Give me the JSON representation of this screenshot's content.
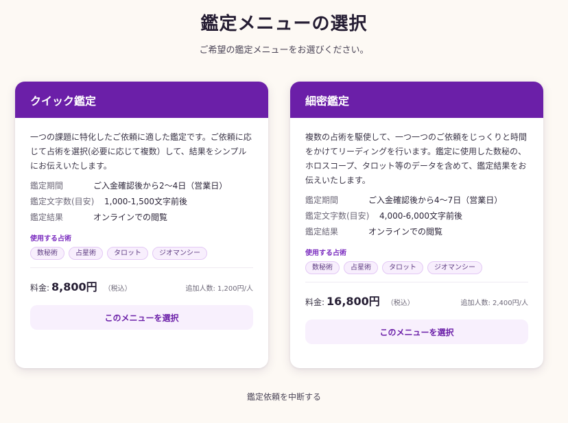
{
  "page": {
    "title": "鑑定メニューの選択",
    "subtitle": "ご希望の鑑定メニューをお選びください。",
    "cancel_label": "鑑定依頼を中断する"
  },
  "colors": {
    "accent": "#6b1fa8",
    "background": "#fdf9f4",
    "tag_bg": "#f8effd"
  },
  "cards": [
    {
      "title": "クイック鑑定",
      "description": "一つの課題に特化したご依頼に適した鑑定です。ご依頼に応じて占術を選択(必要に応じて複数）して、結果をシンプルにお伝えいたします。",
      "period_label": "鑑定期間",
      "period_value": "ご入金確認後から2〜4日（営業日）",
      "chars_label": "鑑定文字数(目安)",
      "chars_value": "1,000-1,500文字前後",
      "result_label": "鑑定結果",
      "result_value": "オンラインでの閲覧",
      "techniques_label": "使用する占術",
      "techniques": [
        "数秘術",
        "占星術",
        "タロット",
        "ジオマンシー"
      ],
      "price_label": "料金:",
      "price": "8,800円",
      "tax": "（税込）",
      "extra_fee": "追加人数: 1,200円/人",
      "button_label": "このメニューを選択"
    },
    {
      "title": "細密鑑定",
      "description": "複数の占術を駆使して、一つ一つのご依頼をじっくりと時間をかけてリーディングを行います。鑑定に使用した数秘の、ホロスコープ、タロット等のデータを含めて、鑑定結果をお伝えいたします。",
      "period_label": "鑑定期間",
      "period_value": "ご入金確認後から4〜7日（営業日）",
      "chars_label": "鑑定文字数(目安)",
      "chars_value": "4,000-6,000文字前後",
      "result_label": "鑑定結果",
      "result_value": "オンラインでの閲覧",
      "techniques_label": "使用する占術",
      "techniques": [
        "数秘術",
        "占星術",
        "タロット",
        "ジオマンシー"
      ],
      "price_label": "料金:",
      "price": "16,800円",
      "tax": "（税込）",
      "extra_fee": "追加人数: 2,400円/人",
      "button_label": "このメニューを選択"
    }
  ]
}
